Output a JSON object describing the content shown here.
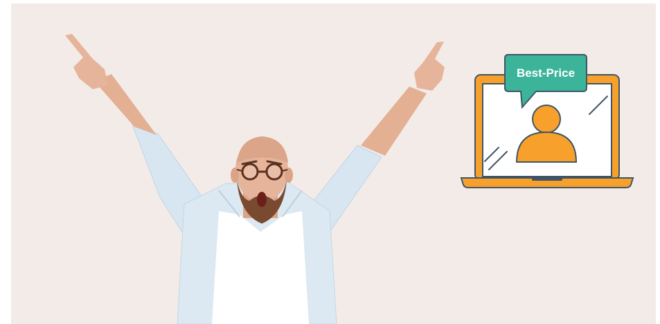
{
  "illustration": {
    "badge_label": "Best-Price",
    "colors": {
      "background": "#f3ebe8",
      "laptop_frame": "#f7a02c",
      "laptop_outline": "#3f5566",
      "speech_bubble": "#3bb49a",
      "avatar": "#f7a02c",
      "shirt": "#dce9f2",
      "tshirt": "#ffffff",
      "skin": "#e6b49a",
      "beard": "#7a4a30"
    }
  },
  "photo": {
    "subject": "excited-man-pointing-up"
  }
}
